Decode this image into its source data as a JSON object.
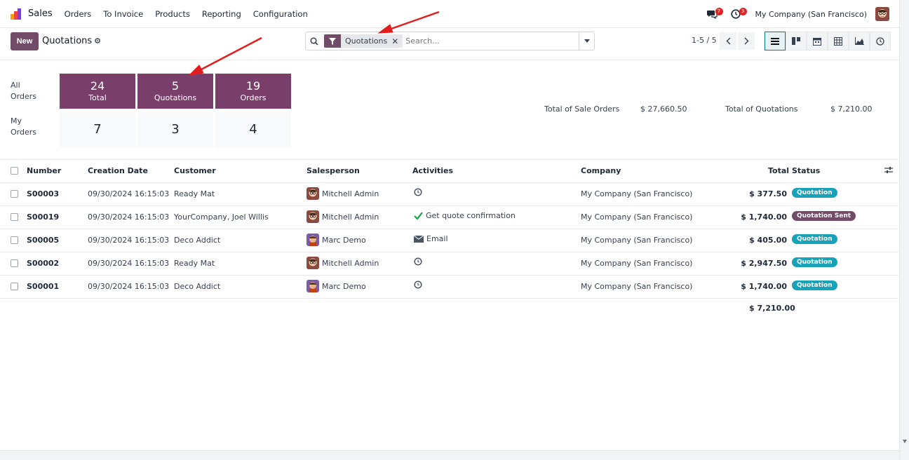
{
  "nav": {
    "app_name": "Sales",
    "menus": [
      "Orders",
      "To Invoice",
      "Products",
      "Reporting",
      "Configuration"
    ],
    "messages_count": "7",
    "activities_count": "3",
    "company": "My Company (San Francisco)"
  },
  "control": {
    "new_label": "New",
    "breadcrumb": "Quotations",
    "facet_label": "Quotations",
    "search_placeholder": "Search...",
    "pager": "1-5 / 5",
    "views": [
      "list-view-icon",
      "kanban-view-icon",
      "calendar-view-icon",
      "pivot-view-icon",
      "graph-view-icon",
      "activity-view-icon"
    ]
  },
  "dashboard": {
    "all_orders_label": "All Orders",
    "my_orders_label": "My Orders",
    "all": [
      {
        "value": "24",
        "label": "Total"
      },
      {
        "value": "5",
        "label": "Quotations"
      },
      {
        "value": "19",
        "label": "Orders"
      }
    ],
    "mine": [
      "7",
      "3",
      "4"
    ],
    "total_sale_orders_label": "Total of Sale Orders",
    "total_sale_orders_value": "$ 27,660.50",
    "total_quotations_label": "Total of Quotations",
    "total_quotations_value": "$ 7,210.00"
  },
  "table": {
    "headers": {
      "number": "Number",
      "creation_date": "Creation Date",
      "customer": "Customer",
      "salesperson": "Salesperson",
      "activities": "Activities",
      "company": "Company",
      "total": "Total",
      "status": "Status"
    },
    "rows": [
      {
        "number": "S00003",
        "date": "09/30/2024 16:15:03",
        "customer": "Ready Mat",
        "salesperson": "Mitchell Admin",
        "activity": "",
        "activity_icon": "clock-icon",
        "company": "My Company (San Francisco)",
        "total": "$ 377.50",
        "status": "Quotation",
        "status_color": "#17a2b8"
      },
      {
        "number": "S00019",
        "date": "09/30/2024 16:15:03",
        "customer": "YourCompany, Joel Willis",
        "salesperson": "Mitchell Admin",
        "activity": "Get quote confirmation",
        "activity_icon": "check-icon",
        "company": "My Company (San Francisco)",
        "total": "$ 1,740.00",
        "status": "Quotation Sent",
        "status_color": "#714b67"
      },
      {
        "number": "S00005",
        "date": "09/30/2024 16:15:03",
        "customer": "Deco Addict",
        "salesperson": "Marc Demo",
        "activity": "Email",
        "activity_icon": "envelope-icon",
        "company": "My Company (San Francisco)",
        "total": "$ 405.00",
        "status": "Quotation",
        "status_color": "#17a2b8"
      },
      {
        "number": "S00002",
        "date": "09/30/2024 16:15:03",
        "customer": "Ready Mat",
        "salesperson": "Mitchell Admin",
        "activity": "",
        "activity_icon": "clock-icon",
        "company": "My Company (San Francisco)",
        "total": "$ 2,947.50",
        "status": "Quotation",
        "status_color": "#17a2b8"
      },
      {
        "number": "S00001",
        "date": "09/30/2024 16:15:03",
        "customer": "Deco Addict",
        "salesperson": "Marc Demo",
        "activity": "",
        "activity_icon": "clock-icon",
        "company": "My Company (San Francisco)",
        "total": "$ 1,740.00",
        "status": "Quotation",
        "status_color": "#17a2b8"
      }
    ],
    "sum_total": "$ 7,210.00"
  },
  "colors": {
    "brand": "#714b67",
    "tile_dark": "#7a3e6b",
    "annotation_arrow": "#e11d1d"
  }
}
